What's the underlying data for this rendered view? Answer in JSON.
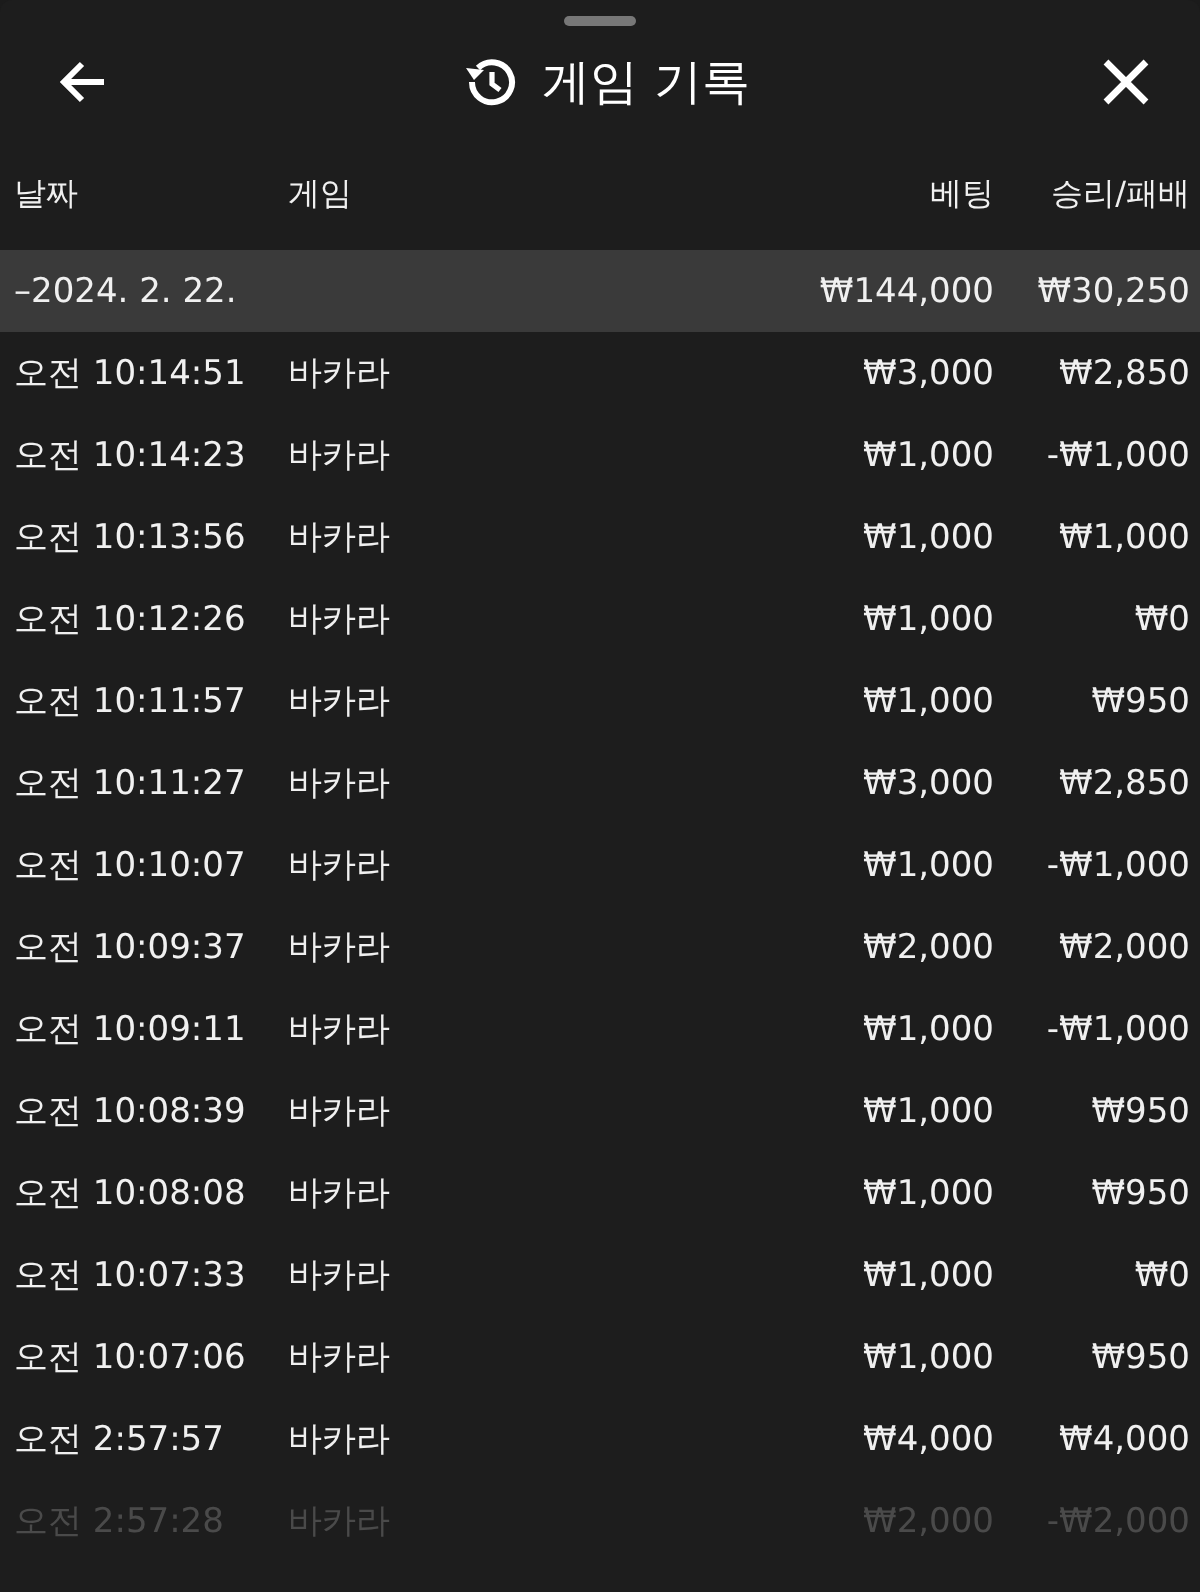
{
  "header": {
    "title": "게임 기록"
  },
  "columns": [
    "날짜",
    "게임",
    "베팅",
    "승리/패배"
  ],
  "date_group": {
    "date": "–2024. 2. 22.",
    "bet": "₩144,000",
    "result": "₩30,250"
  },
  "rows": [
    {
      "time": "오전 10:14:51",
      "game": "바카라",
      "bet": "₩3,000",
      "result": "₩2,850",
      "faded": false
    },
    {
      "time": "오전 10:14:23",
      "game": "바카라",
      "bet": "₩1,000",
      "result": "-₩1,000",
      "faded": false
    },
    {
      "time": "오전 10:13:56",
      "game": "바카라",
      "bet": "₩1,000",
      "result": "₩1,000",
      "faded": false
    },
    {
      "time": "오전 10:12:26",
      "game": "바카라",
      "bet": "₩1,000",
      "result": "₩0",
      "faded": false
    },
    {
      "time": "오전 10:11:57",
      "game": "바카라",
      "bet": "₩1,000",
      "result": "₩950",
      "faded": false
    },
    {
      "time": "오전 10:11:27",
      "game": "바카라",
      "bet": "₩3,000",
      "result": "₩2,850",
      "faded": false
    },
    {
      "time": "오전 10:10:07",
      "game": "바카라",
      "bet": "₩1,000",
      "result": "-₩1,000",
      "faded": false
    },
    {
      "time": "오전 10:09:37",
      "game": "바카라",
      "bet": "₩2,000",
      "result": "₩2,000",
      "faded": false
    },
    {
      "time": "오전 10:09:11",
      "game": "바카라",
      "bet": "₩1,000",
      "result": "-₩1,000",
      "faded": false
    },
    {
      "time": "오전 10:08:39",
      "game": "바카라",
      "bet": "₩1,000",
      "result": "₩950",
      "faded": false
    },
    {
      "time": "오전 10:08:08",
      "game": "바카라",
      "bet": "₩1,000",
      "result": "₩950",
      "faded": false
    },
    {
      "time": "오전 10:07:33",
      "game": "바카라",
      "bet": "₩1,000",
      "result": "₩0",
      "faded": false
    },
    {
      "time": "오전 10:07:06",
      "game": "바카라",
      "bet": "₩1,000",
      "result": "₩950",
      "faded": false
    },
    {
      "time": "오전 2:57:57",
      "game": "바카라",
      "bet": "₩4,000",
      "result": "₩4,000",
      "faded": false
    },
    {
      "time": "오전 2:57:28",
      "game": "바카라",
      "bet": "₩2,000",
      "result": "-₩2,000",
      "faded": true
    }
  ]
}
